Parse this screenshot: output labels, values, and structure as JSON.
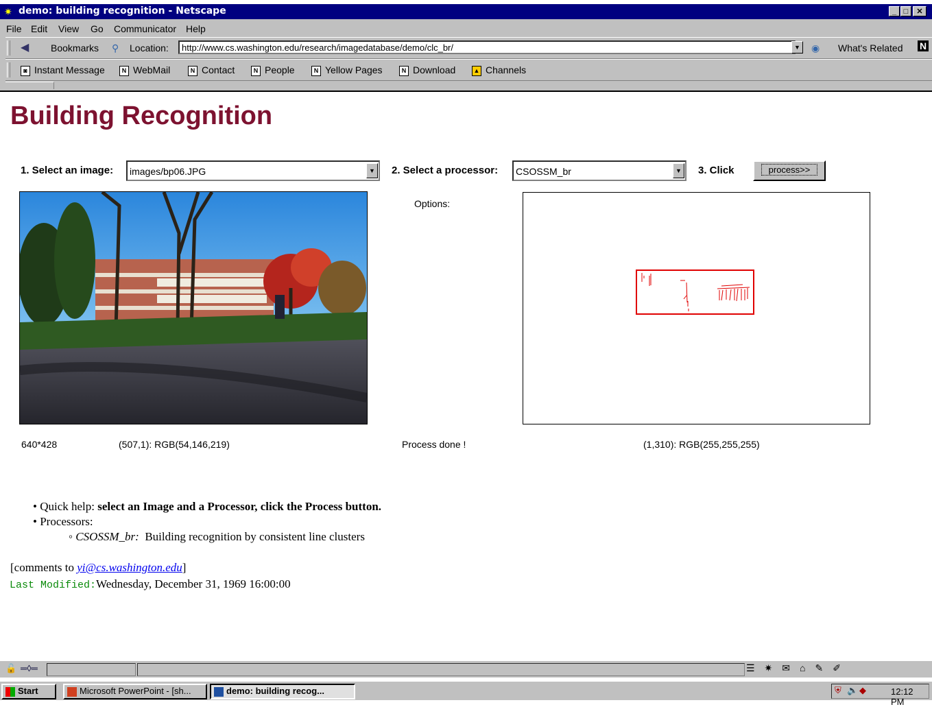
{
  "window": {
    "title": "demo: building recognition - Netscape"
  },
  "menu": [
    "File",
    "Edit",
    "View",
    "Go",
    "Communicator",
    "Help"
  ],
  "nav": {
    "bookmarks_label": "Bookmarks",
    "location_label": "Location:",
    "url": "http://www.cs.washington.edu/research/imagedatabase/demo/clc_br/",
    "whats_related": "What's Related"
  },
  "personal_toolbar": [
    "Instant Message",
    "WebMail",
    "Contact",
    "People",
    "Yellow Pages",
    "Download",
    "Channels"
  ],
  "page": {
    "heading": "Building Recognition",
    "step1_label": "1. Select an image:",
    "image_select": "images/bp06.JPG",
    "step2_label": "2. Select a processor:",
    "processor_select": "CSOSSM_br",
    "step3_label": "3. Click",
    "process_button": "process>>",
    "options_label": "Options:",
    "image_size": "640*428",
    "image_pixel": "(507,1): RGB(54,146,219)",
    "process_status": "Process done !",
    "output_pixel": "(1,310): RGB(255,255,255)"
  },
  "help": {
    "quick_prefix": "Quick help:",
    "quick_text": "select an Image and a Processor, click the Process button.",
    "processors_label": "Processors:",
    "proc_name": "CSOSSM_br:",
    "proc_desc": "Building recognition by consistent line clusters",
    "comments_prefix": "[comments to",
    "comments_email": "yi@cs.washington.edu",
    "comments_suffix": "]",
    "last_modified_label": "Last Modified:",
    "last_modified_value": "Wednesday, December 31, 1969 16:00:00"
  },
  "taskbar": {
    "start": "Start",
    "powerpoint": "Microsoft PowerPoint - [sh...",
    "netscape": "demo: building recog...",
    "clock": "12:12 PM"
  },
  "colors": {
    "heading": "#7d1230",
    "titlebar": "#000080",
    "last_modified": "#0a8a0a",
    "detection_box": "#e00000"
  }
}
